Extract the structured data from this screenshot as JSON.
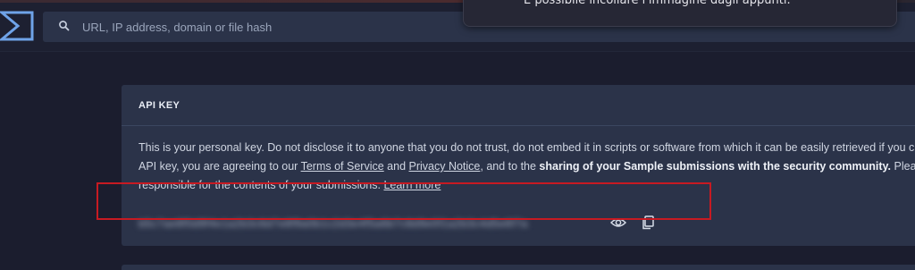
{
  "header": {
    "search_placeholder": "URL, IP address, domain or file hash"
  },
  "notification": {
    "text": "È possibile incollare l'immagine dagli appunti."
  },
  "api_key_card": {
    "title": "API KEY",
    "line1": "This is your personal key. Do not disclose it to anyone that you do not trust, do not embed it in scripts or software from which it can be easily retrieved if you c",
    "line2_pre": "API key, you are agreeing to our ",
    "terms_link": "Terms of Service",
    "and_text": " and ",
    "privacy_link": "Privacy Notice",
    "line2_mid": ", and to the ",
    "line2_bold": "sharing of your Sample submissions with the security community.",
    "line2_post": " Please ",
    "line3_pre": "responsible for the contents of your submissions. ",
    "learn_more_link": "Learn more",
    "key_value": "b5c7ae8f0d9f4e1a2b3c6d7e8f9a0b1c2d3e4f5a6b7c8d9e0f1a2b3c4d5e6f7a",
    "reveal_icon": "eye-icon",
    "copy_icon": "copy-icon"
  },
  "colors": {
    "background": "#1b1d2e",
    "card": "#2b3349",
    "highlight": "#c71a22",
    "logo": "#6fa3e8"
  }
}
